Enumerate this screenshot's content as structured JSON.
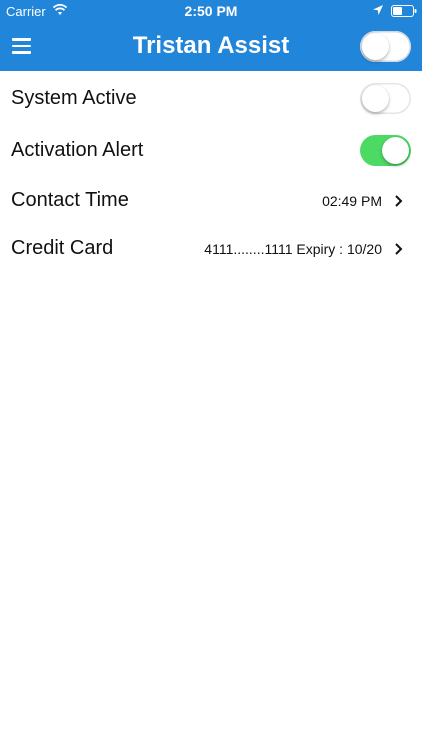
{
  "status_bar": {
    "carrier": "Carrier",
    "time": "2:50 PM",
    "icons": [
      "wifi-icon",
      "location-icon",
      "battery-icon"
    ]
  },
  "header": {
    "title": "Tristan Assist",
    "menu_icon": "hamburger-menu-icon",
    "toggle_on": false,
    "background": "#2185d9"
  },
  "settings": {
    "system_active": {
      "label": "System Active",
      "on": false
    },
    "activation_alert": {
      "label": "Activation Alert",
      "on": true
    },
    "contact_time": {
      "label": "Contact Time",
      "value": "02:49 PM"
    },
    "credit_card": {
      "label": "Credit Card",
      "value": "4111........1111 Expiry : 10/20"
    }
  },
  "colors": {
    "accent": "#2185d9",
    "toggle_on": "#4cd964"
  }
}
